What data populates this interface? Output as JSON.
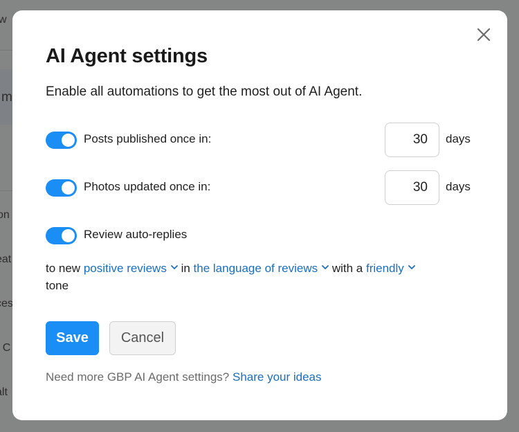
{
  "background": {
    "fragments": [
      "w",
      "m",
      "on",
      "eat",
      "ces",
      "r C",
      "alt"
    ]
  },
  "modal": {
    "title": "AI Agent settings",
    "subtitle": "Enable all automations to get the most out of AI Agent.",
    "close_icon": "close-icon",
    "rows": [
      {
        "label": "Posts published once in:",
        "enabled": true,
        "value": "30",
        "unit": "days"
      },
      {
        "label": "Photos updated once in:",
        "enabled": true,
        "value": "30",
        "unit": "days"
      },
      {
        "label": "Review auto-replies",
        "enabled": true
      }
    ],
    "sentence": {
      "part1": "to new",
      "dropdown1": "positive reviews",
      "part2": "in",
      "dropdown2": "the language of reviews",
      "part3": "with a",
      "dropdown3": "friendly",
      "part4": "tone"
    },
    "save_label": "Save",
    "cancel_label": "Cancel",
    "footer_text": "Need more GBP AI Agent settings?",
    "footer_link": "Share your ideas"
  },
  "colors": {
    "accent": "#1a8ef4",
    "link": "#1a6fbf",
    "overlay": "#6f6f6f"
  }
}
